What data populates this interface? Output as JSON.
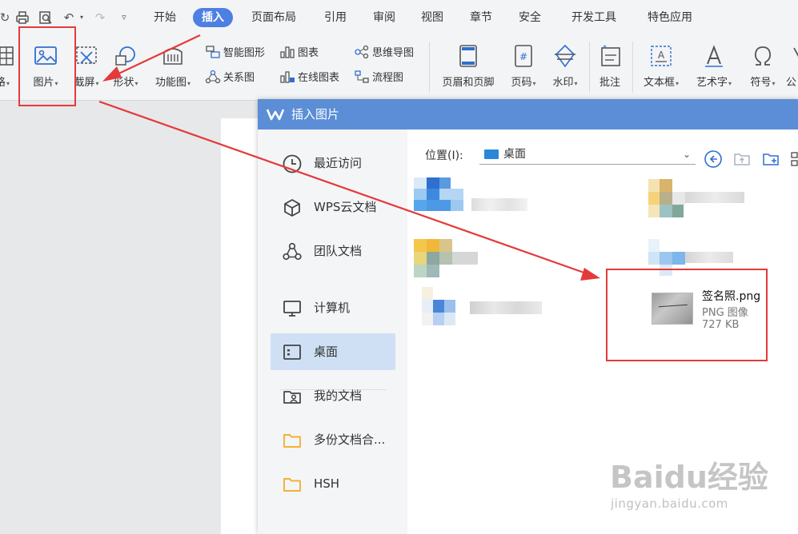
{
  "menubar": {
    "tabs": [
      "开始",
      "插入",
      "页面布局",
      "引用",
      "审阅",
      "视图",
      "章节",
      "安全",
      "开发工具",
      "特色应用"
    ],
    "active_tab": "插入"
  },
  "ribbon": {
    "large_buttons": [
      "格",
      "图片",
      "截屏",
      "形状",
      "功能图",
      "页眉和页脚",
      "页码",
      "水印",
      "批注",
      "文本框",
      "艺术字",
      "符号",
      "公"
    ],
    "small_buttons": [
      "智能图形",
      "图表",
      "思维导图",
      "关系图",
      "在线图表",
      "流程图"
    ]
  },
  "dialog": {
    "title": "插入图片",
    "sidebar": [
      "最近访问",
      "WPS云文档",
      "团队文档",
      "计算机",
      "桌面",
      "我的文档",
      "多份文档合...",
      "HSH"
    ],
    "selected_sidebar": "桌面",
    "location_label": "位置(I):",
    "location_value": "桌面",
    "file": {
      "name": "签名照.png",
      "type": "PNG 图像",
      "size": "727 KB"
    }
  },
  "watermark": {
    "logo": "Baidu经验",
    "url": "jingyan.baidu.com"
  },
  "colors": {
    "accent": "#4e7fe2",
    "dialog_title": "#5b8ed6",
    "selection": "#cfe0f5",
    "annotation": "#e53a3a"
  }
}
